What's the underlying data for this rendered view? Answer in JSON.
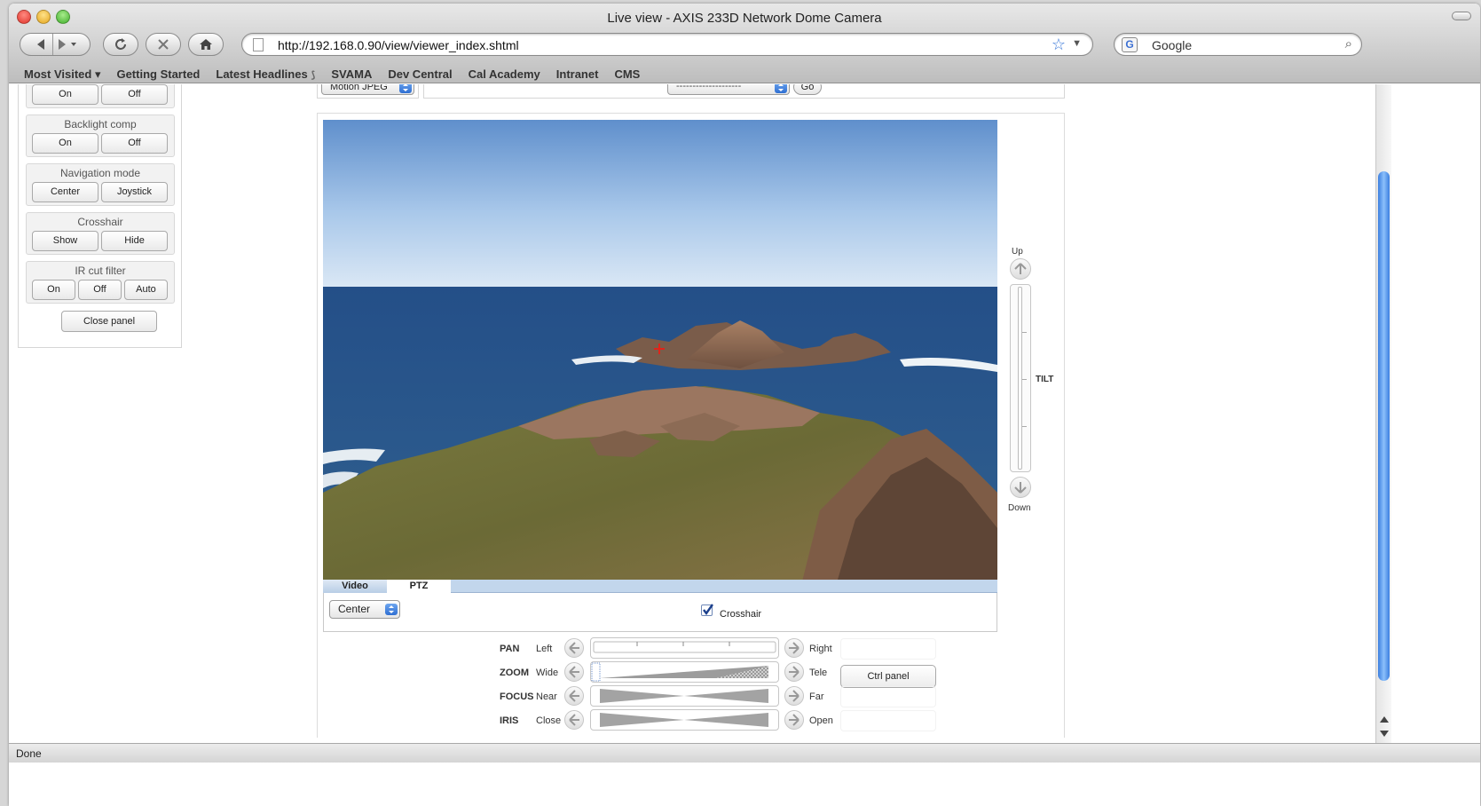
{
  "window": {
    "title": "Live view - AXIS 233D Network Dome Camera"
  },
  "toolbar": {
    "url": "http://192.168.0.90/view/viewer_index.shtml",
    "search_placeholder": "Google"
  },
  "bookmarks": [
    "Most Visited ▾",
    "Getting Started",
    "Latest Headlines",
    "SVAMA",
    "Dev Central",
    "Cal Academy",
    "Intranet",
    "CMS"
  ],
  "panel": {
    "top_group": {
      "on": "On",
      "off": "Off"
    },
    "backlight": {
      "label": "Backlight comp",
      "on": "On",
      "off": "Off"
    },
    "navigation": {
      "label": "Navigation mode",
      "center": "Center",
      "joystick": "Joystick"
    },
    "crosshair": {
      "label": "Crosshair",
      "show": "Show",
      "hide": "Hide"
    },
    "ircut": {
      "label": "IR cut filter",
      "on": "On",
      "off": "Off",
      "auto": "Auto"
    },
    "close": "Close panel"
  },
  "top_controls": {
    "format": "Motion JPEG",
    "preset": "--------------------",
    "go": "Go"
  },
  "tabs": {
    "video": "Video",
    "ptz": "PTZ"
  },
  "ptz_options": {
    "mode": "Center",
    "crosshair_label": "Crosshair",
    "crosshair_checked": true
  },
  "tilt": {
    "up": "Up",
    "down": "Down",
    "label": "TILT"
  },
  "ptz_rows": [
    {
      "name": "PAN",
      "left": "Left",
      "right": "Right"
    },
    {
      "name": "ZOOM",
      "left": "Wide",
      "right": "Tele"
    },
    {
      "name": "FOCUS",
      "left": "Near",
      "right": "Far"
    },
    {
      "name": "IRIS",
      "left": "Close",
      "right": "Open"
    }
  ],
  "ctrl_panel": "Ctrl panel",
  "status": "Done",
  "colors": {
    "accent": "#3b7fe0",
    "crosshair": "#e0241a"
  }
}
